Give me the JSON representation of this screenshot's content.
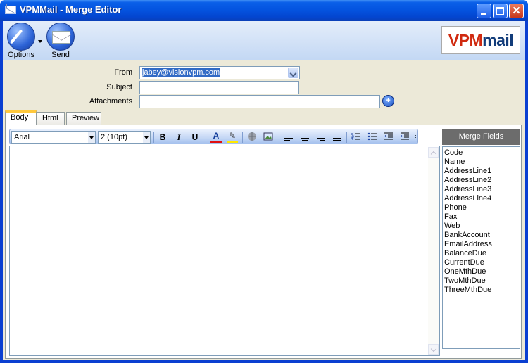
{
  "window": {
    "title": "VPMMail - Merge Editor",
    "close_glyph": "✕"
  },
  "ribbon": {
    "options_label": "Options",
    "send_label": "Send",
    "logo": {
      "v": "V",
      "pm": "PM",
      "mail": "mail"
    }
  },
  "form": {
    "from_label": "From",
    "from_value": "jabey@visionvpm.com",
    "subject_label": "Subject",
    "subject_value": "",
    "attachments_label": "Attachments",
    "attachments_value": "",
    "attach_button_glyph": "+"
  },
  "tabs": [
    {
      "label": "Body",
      "active": true
    },
    {
      "label": "Html",
      "active": false
    },
    {
      "label": "Preview",
      "active": false
    }
  ],
  "toolbar": {
    "font": "Arial",
    "size": "2 (10pt)",
    "bold": "B",
    "italic": "I",
    "underline": "U",
    "font_color": "A",
    "highlight": "✎"
  },
  "merge_fields": {
    "header": "Merge Fields",
    "items": [
      "Code",
      "Name",
      "AddressLine1",
      "AddressLine2",
      "AddressLine3",
      "AddressLine4",
      "Phone",
      "Fax",
      "Web",
      "BankAccount",
      "EmailAddress",
      "BalanceDue",
      "CurrentDue",
      "OneMthDue",
      "TwoMthDue",
      "ThreeMthDue"
    ]
  },
  "colors": {
    "titlebar": "#0454e0",
    "selection": "#316ac5",
    "active_tab_accent": "#ffc83c",
    "merge_header": "#6c6c6c"
  }
}
